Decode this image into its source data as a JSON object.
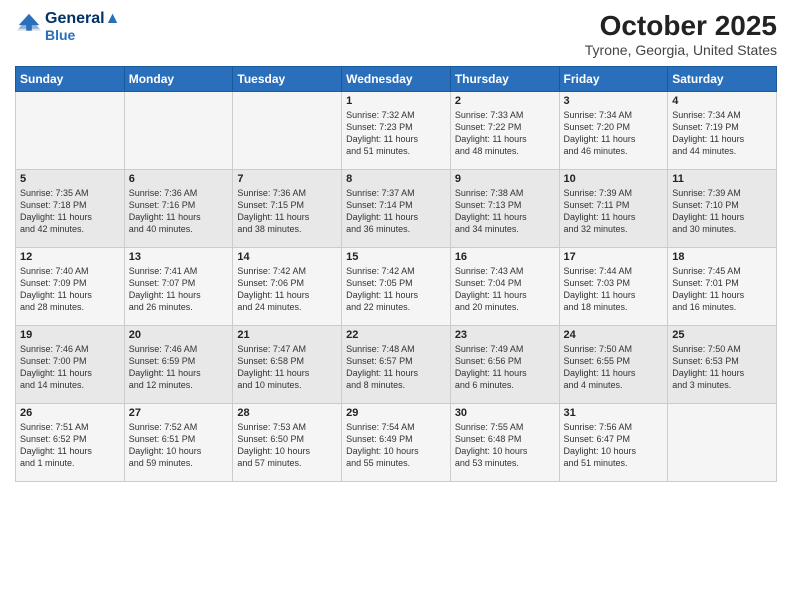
{
  "header": {
    "logo_line1": "General",
    "logo_line2": "Blue",
    "month_title": "October 2025",
    "location": "Tyrone, Georgia, United States"
  },
  "weekdays": [
    "Sunday",
    "Monday",
    "Tuesday",
    "Wednesday",
    "Thursday",
    "Friday",
    "Saturday"
  ],
  "weeks": [
    [
      {
        "day": "",
        "info": ""
      },
      {
        "day": "",
        "info": ""
      },
      {
        "day": "",
        "info": ""
      },
      {
        "day": "1",
        "info": "Sunrise: 7:32 AM\nSunset: 7:23 PM\nDaylight: 11 hours\nand 51 minutes."
      },
      {
        "day": "2",
        "info": "Sunrise: 7:33 AM\nSunset: 7:22 PM\nDaylight: 11 hours\nand 48 minutes."
      },
      {
        "day": "3",
        "info": "Sunrise: 7:34 AM\nSunset: 7:20 PM\nDaylight: 11 hours\nand 46 minutes."
      },
      {
        "day": "4",
        "info": "Sunrise: 7:34 AM\nSunset: 7:19 PM\nDaylight: 11 hours\nand 44 minutes."
      }
    ],
    [
      {
        "day": "5",
        "info": "Sunrise: 7:35 AM\nSunset: 7:18 PM\nDaylight: 11 hours\nand 42 minutes."
      },
      {
        "day": "6",
        "info": "Sunrise: 7:36 AM\nSunset: 7:16 PM\nDaylight: 11 hours\nand 40 minutes."
      },
      {
        "day": "7",
        "info": "Sunrise: 7:36 AM\nSunset: 7:15 PM\nDaylight: 11 hours\nand 38 minutes."
      },
      {
        "day": "8",
        "info": "Sunrise: 7:37 AM\nSunset: 7:14 PM\nDaylight: 11 hours\nand 36 minutes."
      },
      {
        "day": "9",
        "info": "Sunrise: 7:38 AM\nSunset: 7:13 PM\nDaylight: 11 hours\nand 34 minutes."
      },
      {
        "day": "10",
        "info": "Sunrise: 7:39 AM\nSunset: 7:11 PM\nDaylight: 11 hours\nand 32 minutes."
      },
      {
        "day": "11",
        "info": "Sunrise: 7:39 AM\nSunset: 7:10 PM\nDaylight: 11 hours\nand 30 minutes."
      }
    ],
    [
      {
        "day": "12",
        "info": "Sunrise: 7:40 AM\nSunset: 7:09 PM\nDaylight: 11 hours\nand 28 minutes."
      },
      {
        "day": "13",
        "info": "Sunrise: 7:41 AM\nSunset: 7:07 PM\nDaylight: 11 hours\nand 26 minutes."
      },
      {
        "day": "14",
        "info": "Sunrise: 7:42 AM\nSunset: 7:06 PM\nDaylight: 11 hours\nand 24 minutes."
      },
      {
        "day": "15",
        "info": "Sunrise: 7:42 AM\nSunset: 7:05 PM\nDaylight: 11 hours\nand 22 minutes."
      },
      {
        "day": "16",
        "info": "Sunrise: 7:43 AM\nSunset: 7:04 PM\nDaylight: 11 hours\nand 20 minutes."
      },
      {
        "day": "17",
        "info": "Sunrise: 7:44 AM\nSunset: 7:03 PM\nDaylight: 11 hours\nand 18 minutes."
      },
      {
        "day": "18",
        "info": "Sunrise: 7:45 AM\nSunset: 7:01 PM\nDaylight: 11 hours\nand 16 minutes."
      }
    ],
    [
      {
        "day": "19",
        "info": "Sunrise: 7:46 AM\nSunset: 7:00 PM\nDaylight: 11 hours\nand 14 minutes."
      },
      {
        "day": "20",
        "info": "Sunrise: 7:46 AM\nSunset: 6:59 PM\nDaylight: 11 hours\nand 12 minutes."
      },
      {
        "day": "21",
        "info": "Sunrise: 7:47 AM\nSunset: 6:58 PM\nDaylight: 11 hours\nand 10 minutes."
      },
      {
        "day": "22",
        "info": "Sunrise: 7:48 AM\nSunset: 6:57 PM\nDaylight: 11 hours\nand 8 minutes."
      },
      {
        "day": "23",
        "info": "Sunrise: 7:49 AM\nSunset: 6:56 PM\nDaylight: 11 hours\nand 6 minutes."
      },
      {
        "day": "24",
        "info": "Sunrise: 7:50 AM\nSunset: 6:55 PM\nDaylight: 11 hours\nand 4 minutes."
      },
      {
        "day": "25",
        "info": "Sunrise: 7:50 AM\nSunset: 6:53 PM\nDaylight: 11 hours\nand 3 minutes."
      }
    ],
    [
      {
        "day": "26",
        "info": "Sunrise: 7:51 AM\nSunset: 6:52 PM\nDaylight: 11 hours\nand 1 minute."
      },
      {
        "day": "27",
        "info": "Sunrise: 7:52 AM\nSunset: 6:51 PM\nDaylight: 10 hours\nand 59 minutes."
      },
      {
        "day": "28",
        "info": "Sunrise: 7:53 AM\nSunset: 6:50 PM\nDaylight: 10 hours\nand 57 minutes."
      },
      {
        "day": "29",
        "info": "Sunrise: 7:54 AM\nSunset: 6:49 PM\nDaylight: 10 hours\nand 55 minutes."
      },
      {
        "day": "30",
        "info": "Sunrise: 7:55 AM\nSunset: 6:48 PM\nDaylight: 10 hours\nand 53 minutes."
      },
      {
        "day": "31",
        "info": "Sunrise: 7:56 AM\nSunset: 6:47 PM\nDaylight: 10 hours\nand 51 minutes."
      },
      {
        "day": "",
        "info": ""
      }
    ]
  ]
}
